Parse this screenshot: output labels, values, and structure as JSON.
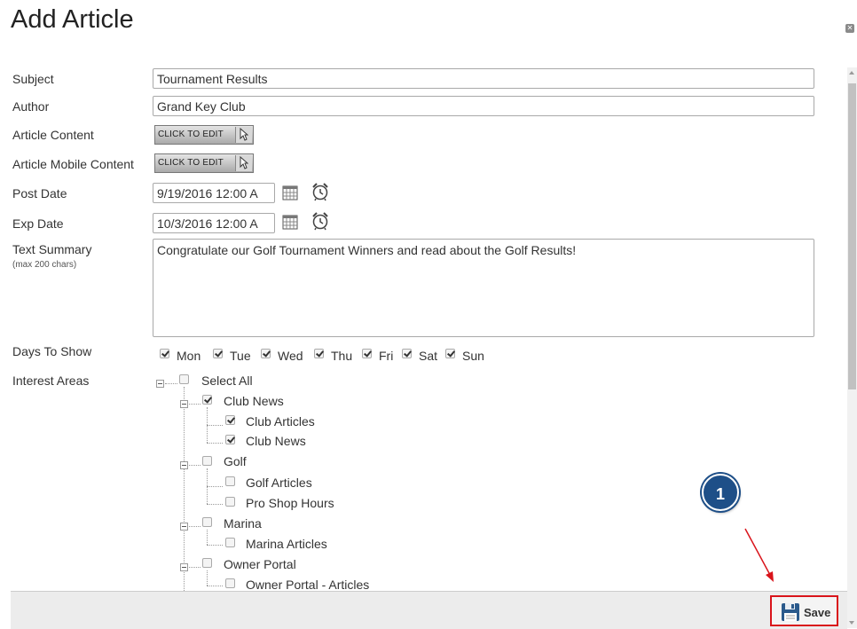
{
  "dialog": {
    "title": "Add Article"
  },
  "form": {
    "subject_label": "Subject",
    "subject_value": "Tournament Results",
    "author_label": "Author",
    "author_value": "Grand Key Club",
    "article_content_label": "Article Content",
    "article_mobile_content_label": "Article Mobile Content",
    "click_to_edit": "CLICK TO EDIT",
    "post_date_label": "Post Date",
    "post_date_value": "9/19/2016 12:00 A",
    "exp_date_label": "Exp Date",
    "exp_date_value": "10/3/2016 12:00 A",
    "text_summary_label": "Text Summary",
    "text_summary_hint": "(max 200 chars)",
    "text_summary_value": "Congratulate our Golf Tournament Winners and read about the Golf Results!",
    "days_label": "Days To Show",
    "days": [
      {
        "label": "Mon",
        "checked": true
      },
      {
        "label": "Tue",
        "checked": true
      },
      {
        "label": "Wed",
        "checked": true
      },
      {
        "label": "Thu",
        "checked": true
      },
      {
        "label": "Fri",
        "checked": true
      },
      {
        "label": "Sat",
        "checked": true
      },
      {
        "label": "Sun",
        "checked": true
      }
    ],
    "interest_label": "Interest Areas"
  },
  "tree": {
    "select_all": "Select All",
    "groups": [
      {
        "label": "Club News",
        "checked": true,
        "children": [
          {
            "label": "Club Articles",
            "checked": true
          },
          {
            "label": "Club News",
            "checked": true
          }
        ]
      },
      {
        "label": "Golf",
        "checked": false,
        "children": [
          {
            "label": "Golf Articles",
            "checked": false
          },
          {
            "label": "Pro Shop Hours",
            "checked": false
          }
        ]
      },
      {
        "label": "Marina",
        "checked": false,
        "children": [
          {
            "label": "Marina Articles",
            "checked": false
          }
        ]
      },
      {
        "label": "Owner Portal",
        "checked": false,
        "children": [
          {
            "label": "Owner Portal - Articles",
            "checked": false
          }
        ]
      }
    ]
  },
  "footer": {
    "save_label": "Save"
  },
  "annotation": {
    "step_number": "1",
    "accent": "#1e4f88",
    "highlight": "#d9141b"
  },
  "icons": {
    "calendar": "calendar-icon",
    "clock": "alarm-clock-icon",
    "save": "floppy-disk-icon",
    "close": "close-icon",
    "cursor": "cursor-arrow-icon"
  }
}
